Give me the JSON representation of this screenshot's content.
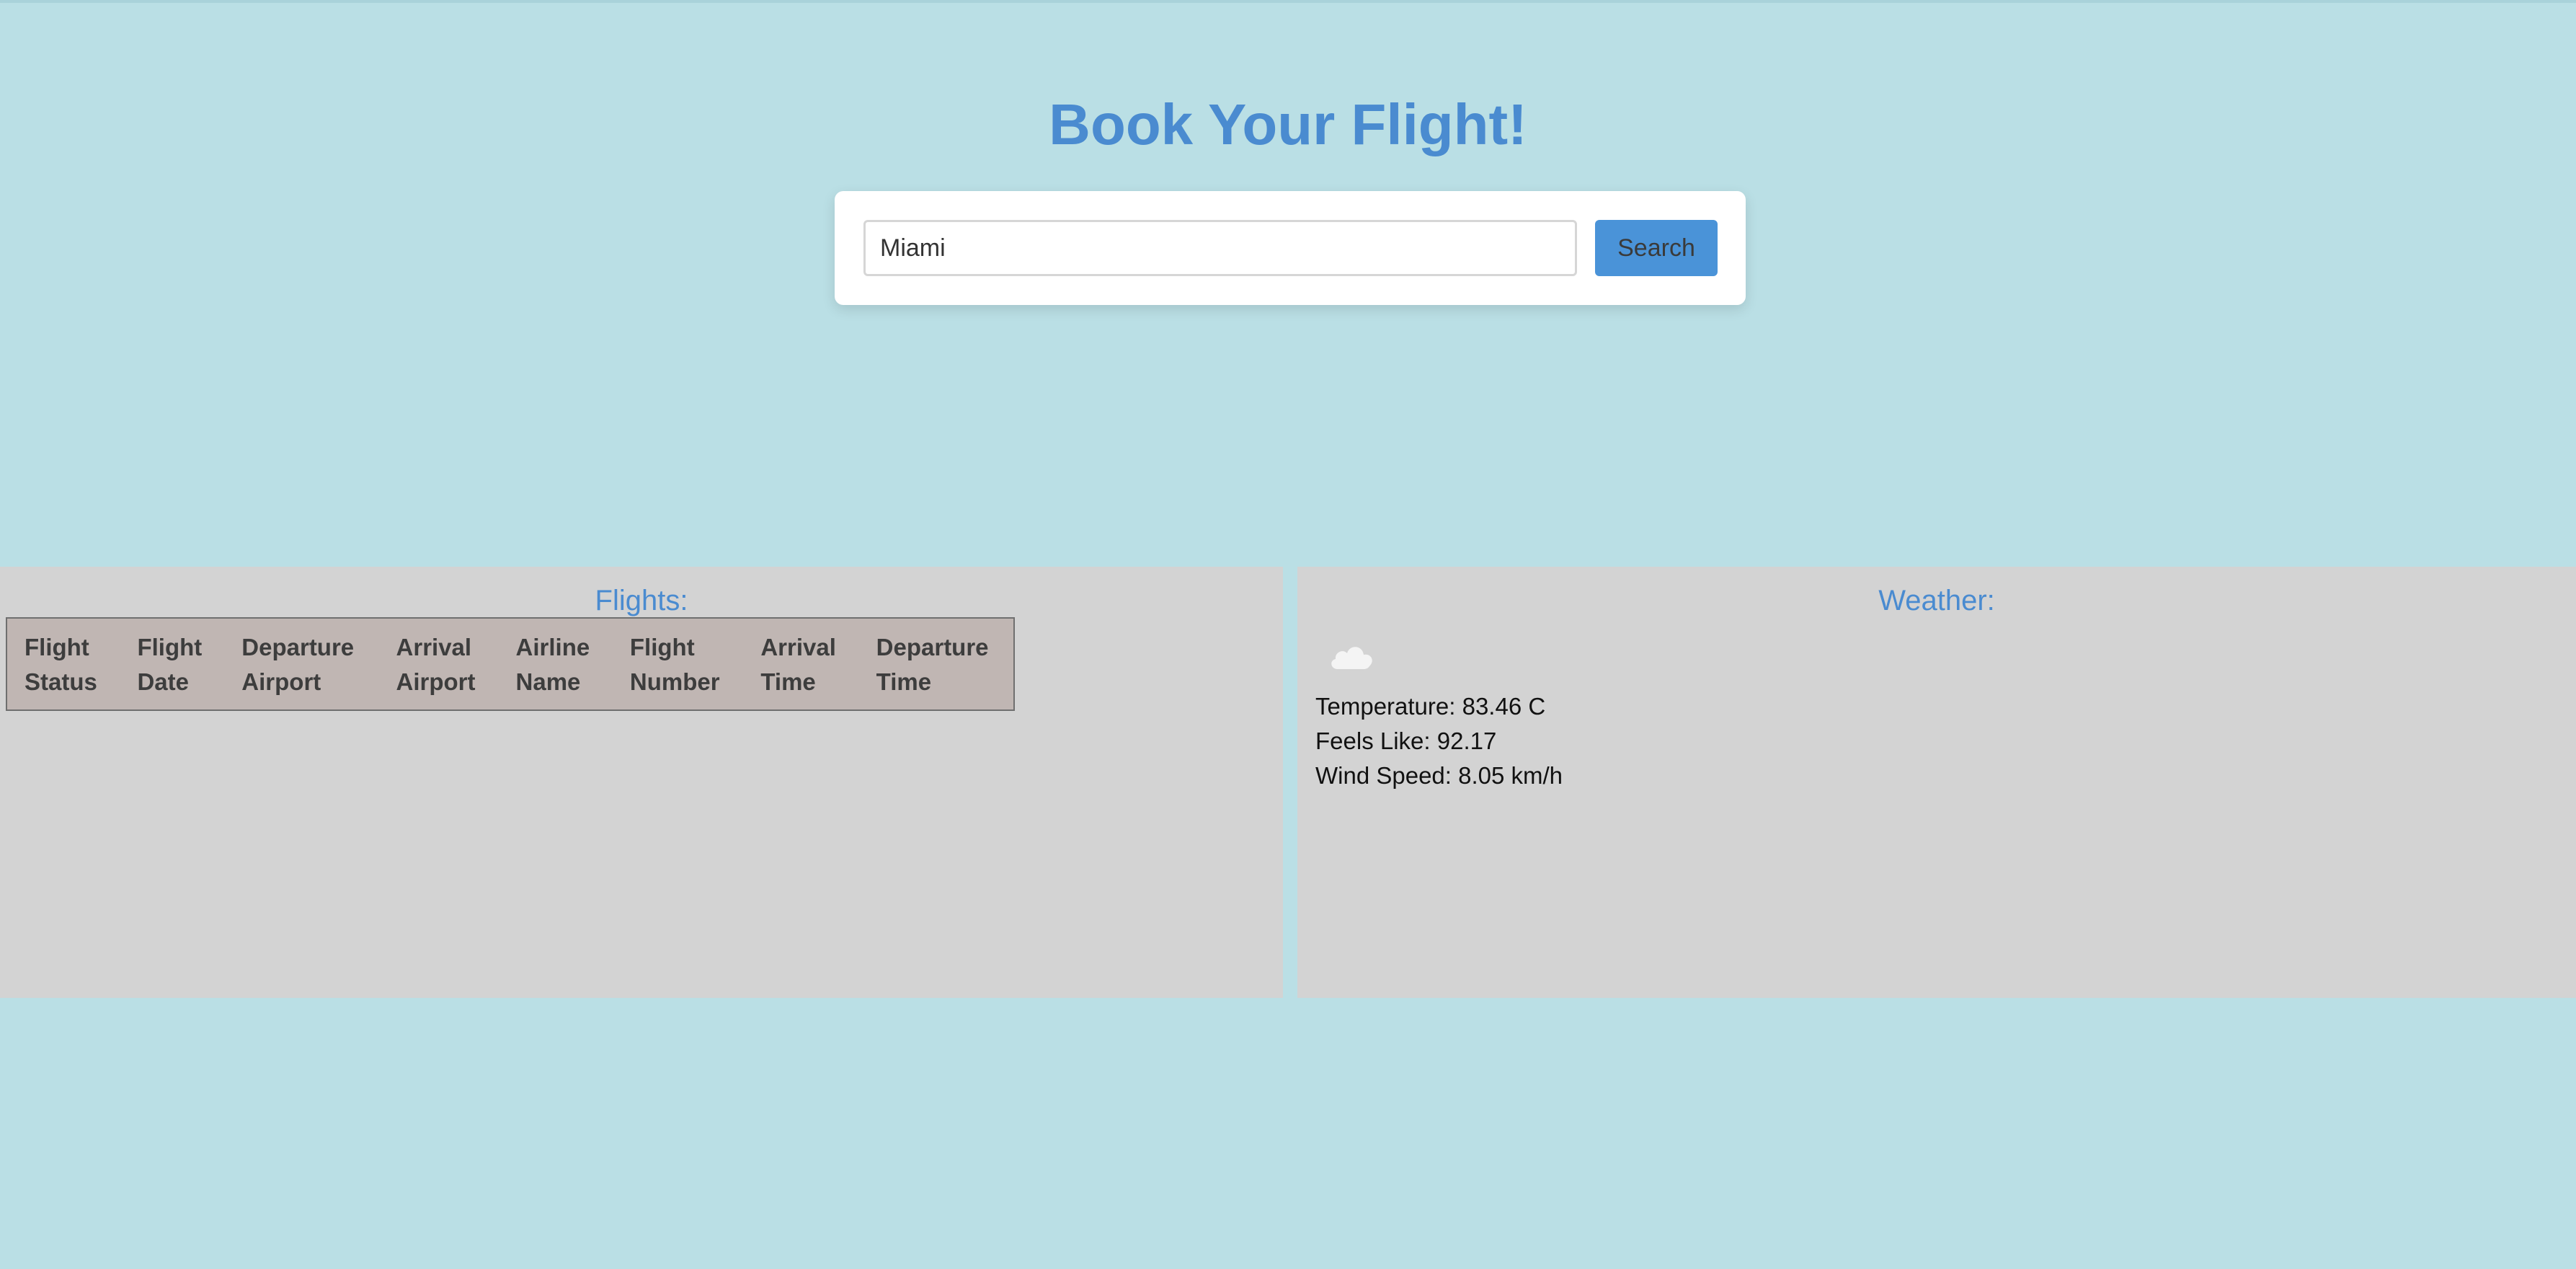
{
  "header": {
    "title": "Book Your Flight!"
  },
  "search": {
    "value": "Miami",
    "placeholder": "",
    "button_label": "Search"
  },
  "flights": {
    "title": "Flights:",
    "columns": [
      [
        "Flight",
        "Status"
      ],
      [
        "Flight",
        "Date"
      ],
      [
        "Departure",
        "Airport"
      ],
      [
        "Arrival",
        "Airport"
      ],
      [
        "Airline",
        "Name"
      ],
      [
        "Flight",
        "Number"
      ],
      [
        "Arrival",
        "Time"
      ],
      [
        "Departure",
        "Time"
      ]
    ],
    "rows": []
  },
  "weather": {
    "title": "Weather:",
    "icon": "cloud-icon",
    "temperature": "Temperature: 83.46 C",
    "feels_like": "Feels Like: 92.17",
    "wind_speed": "Wind Speed: 8.05 km/h"
  },
  "colors": {
    "background": "#badfe5",
    "accent": "#4a8bd0",
    "button": "#4a93d8",
    "panel": "#d3d3d3",
    "table_header": "#c0b6b3"
  }
}
